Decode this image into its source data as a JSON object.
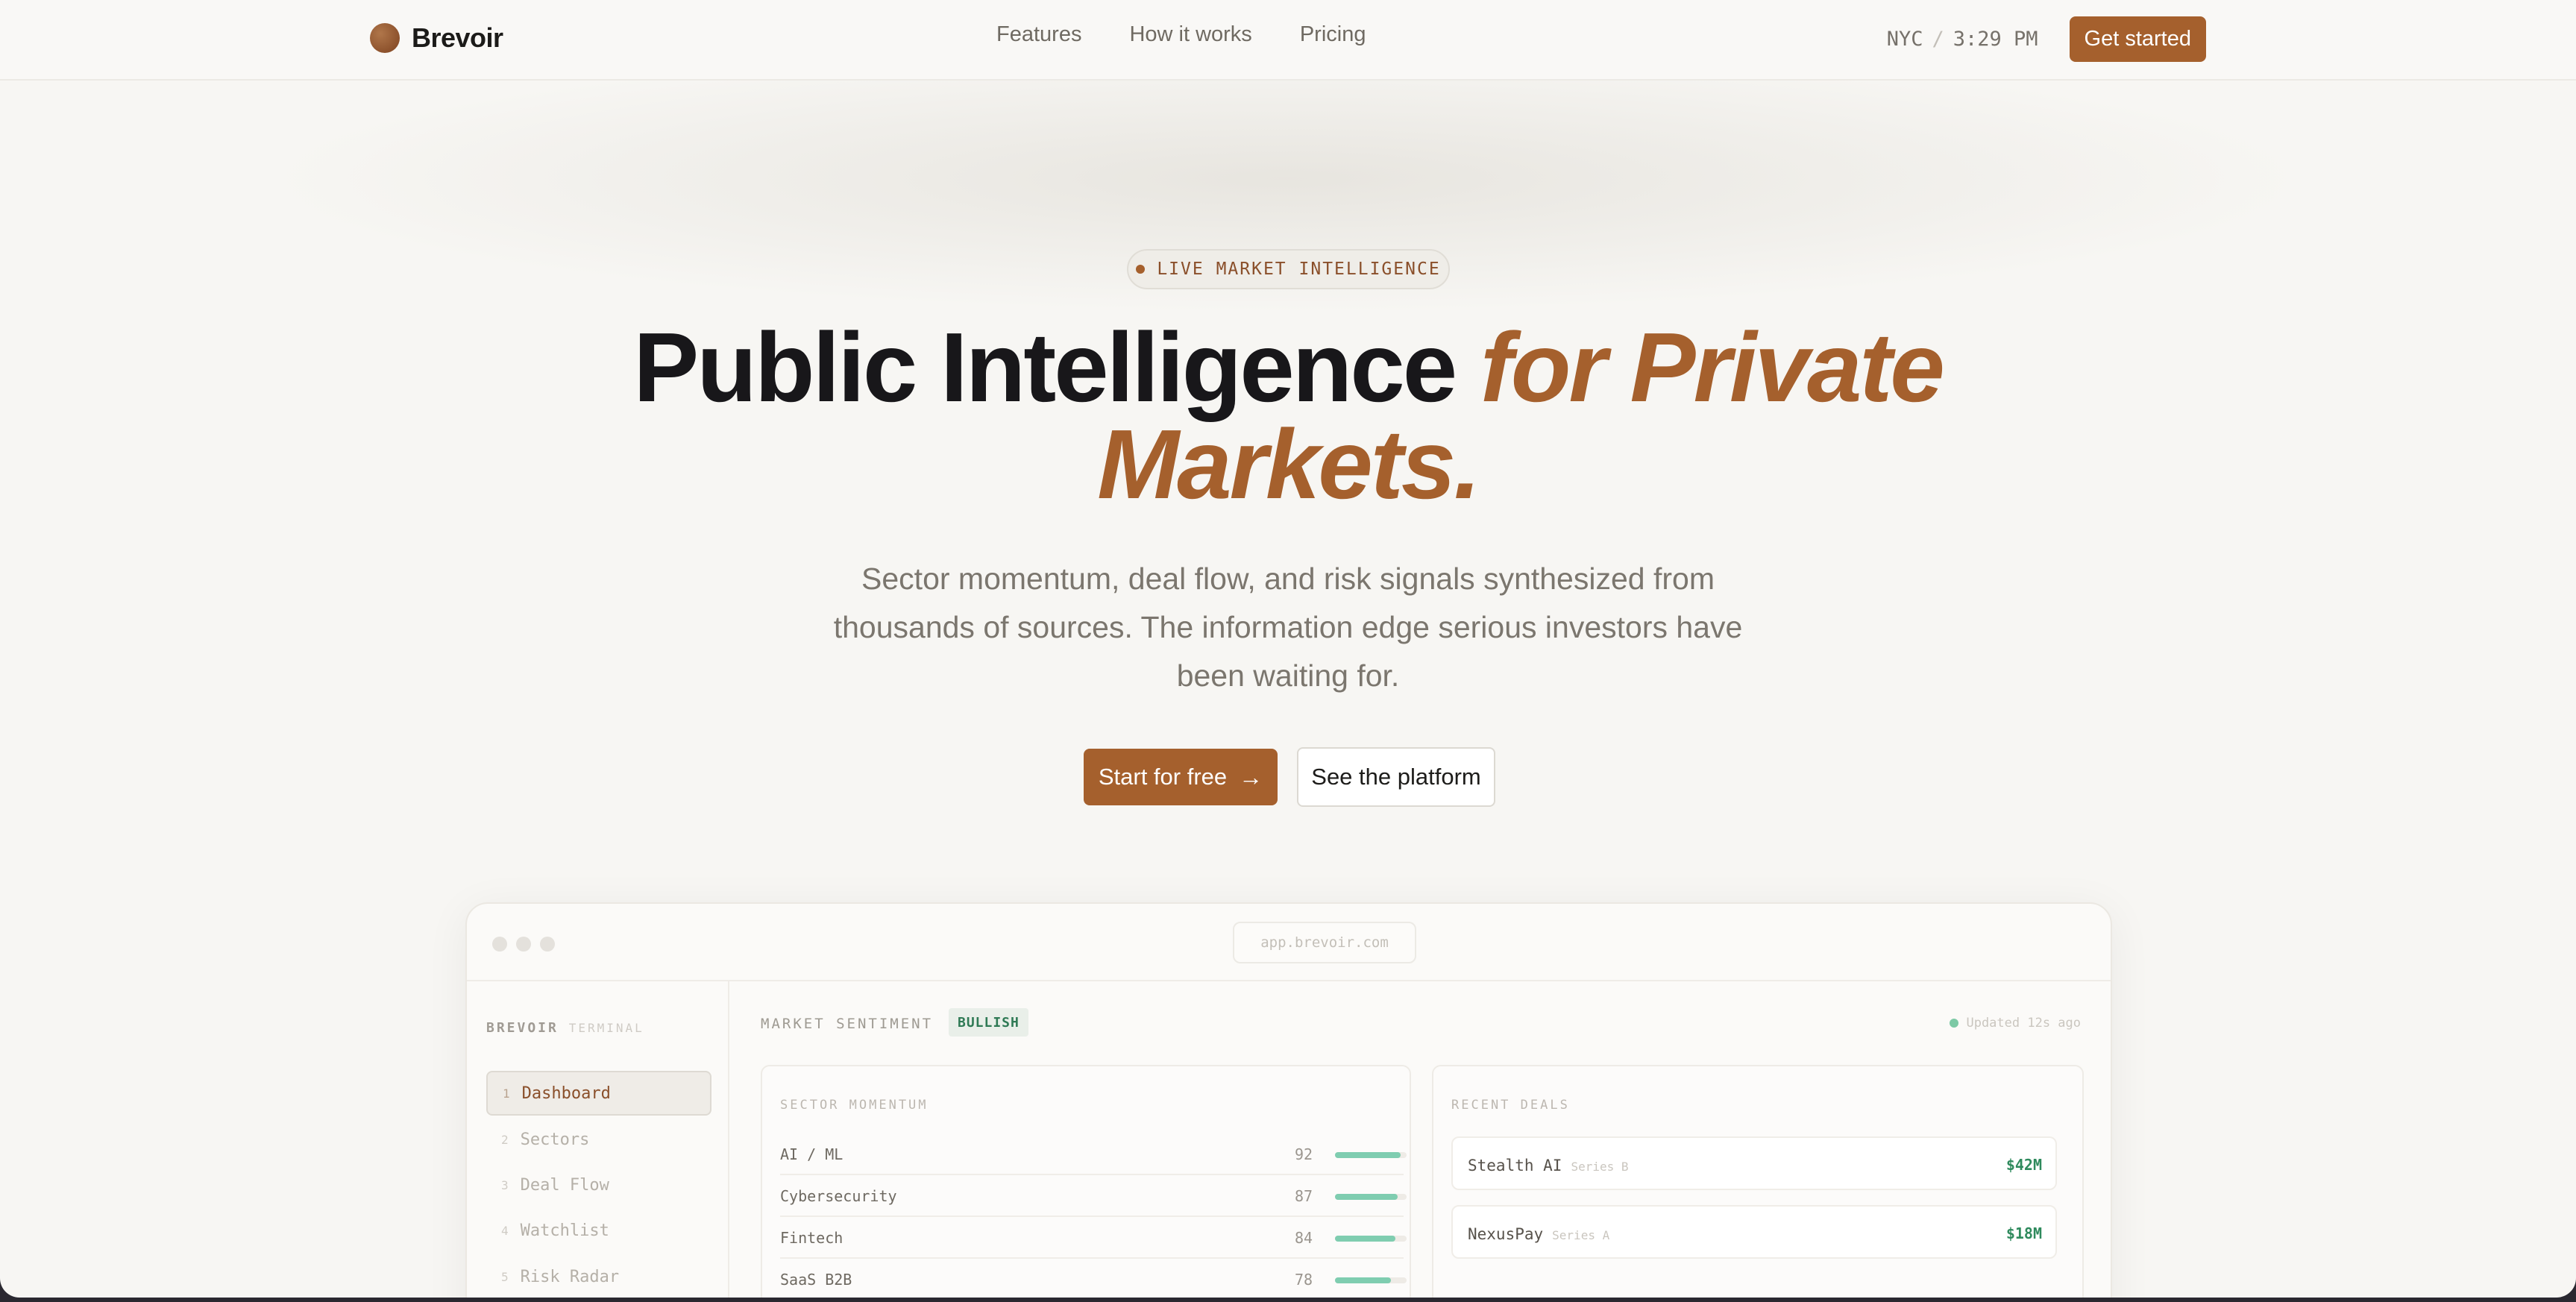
{
  "nav": {
    "brand": "Brevoir",
    "links": [
      "Features",
      "How it works",
      "Pricing"
    ],
    "city": "NYC",
    "separator": "/",
    "time": "3:29 PM",
    "cta": "Get started"
  },
  "hero": {
    "badge": "LIVE MARKET INTELLIGENCE",
    "headline_plain": "Public Intelligence ",
    "headline_accent_1": "for Private",
    "headline_accent_2": "Markets.",
    "subtext": "Sector momentum, deal flow, and risk signals synthesized from thousands of sources. The information edge serious investors have been waiting for.",
    "primary_cta": "Start for free",
    "primary_cta_icon": "arrow-right-icon",
    "secondary_cta": "See the platform"
  },
  "app": {
    "url": "app.brevoir.com",
    "sidebar": {
      "brand": "BREVOIR",
      "brand_suffix": "TERMINAL",
      "items": [
        {
          "num": "1",
          "label": "Dashboard",
          "active": true
        },
        {
          "num": "2",
          "label": "Sectors",
          "active": false
        },
        {
          "num": "3",
          "label": "Deal Flow",
          "active": false
        },
        {
          "num": "4",
          "label": "Watchlist",
          "active": false
        },
        {
          "num": "5",
          "label": "Risk Radar",
          "active": false
        }
      ]
    },
    "header": {
      "label": "MARKET SENTIMENT",
      "sentiment": "BULLISH",
      "updated": "Updated 12s ago"
    },
    "sector_momentum": {
      "title": "SECTOR MOMENTUM",
      "rows": [
        {
          "name": "AI / ML",
          "score": "92",
          "level": 0.92
        },
        {
          "name": "Cybersecurity",
          "score": "87",
          "level": 0.87
        },
        {
          "name": "Fintech",
          "score": "84",
          "level": 0.84
        },
        {
          "name": "SaaS B2B",
          "score": "78",
          "level": 0.78
        }
      ]
    },
    "recent_deals": {
      "title": "RECENT DEALS",
      "items": [
        {
          "name": "Stealth AI",
          "series": "Series B",
          "amount": "$42M"
        },
        {
          "name": "NexusPay",
          "series": "Series A",
          "amount": "$18M"
        }
      ]
    }
  },
  "colors": {
    "accent": "#a5602d",
    "positive": "#2f8a5d",
    "bar": "#7fcdb0"
  }
}
